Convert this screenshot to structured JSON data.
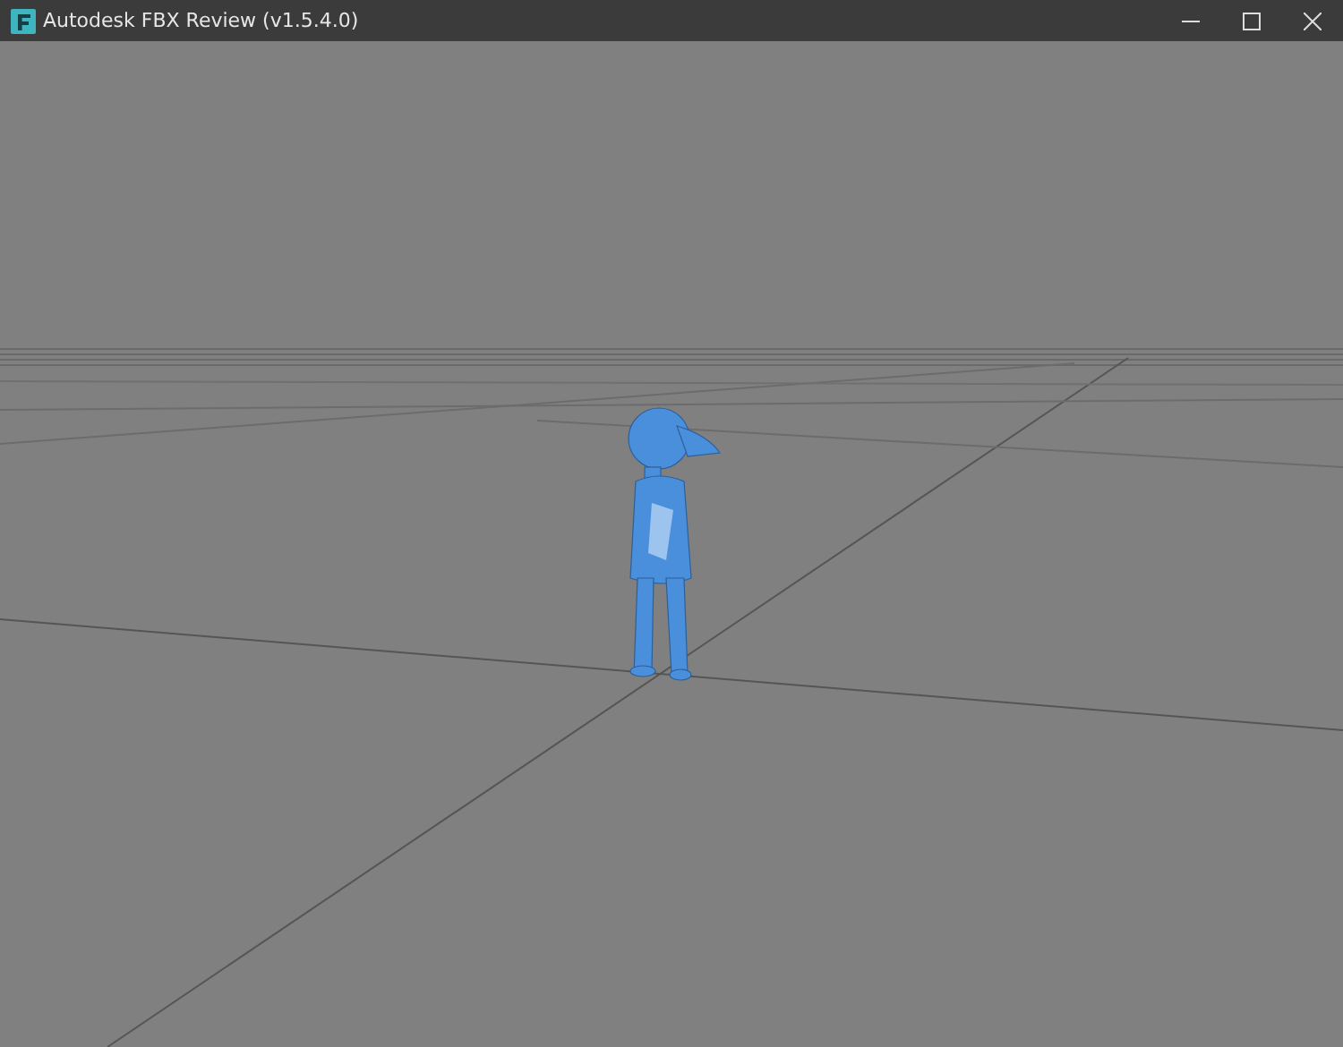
{
  "window": {
    "title": "Autodesk FBX Review (v1.5.4.0)"
  }
}
